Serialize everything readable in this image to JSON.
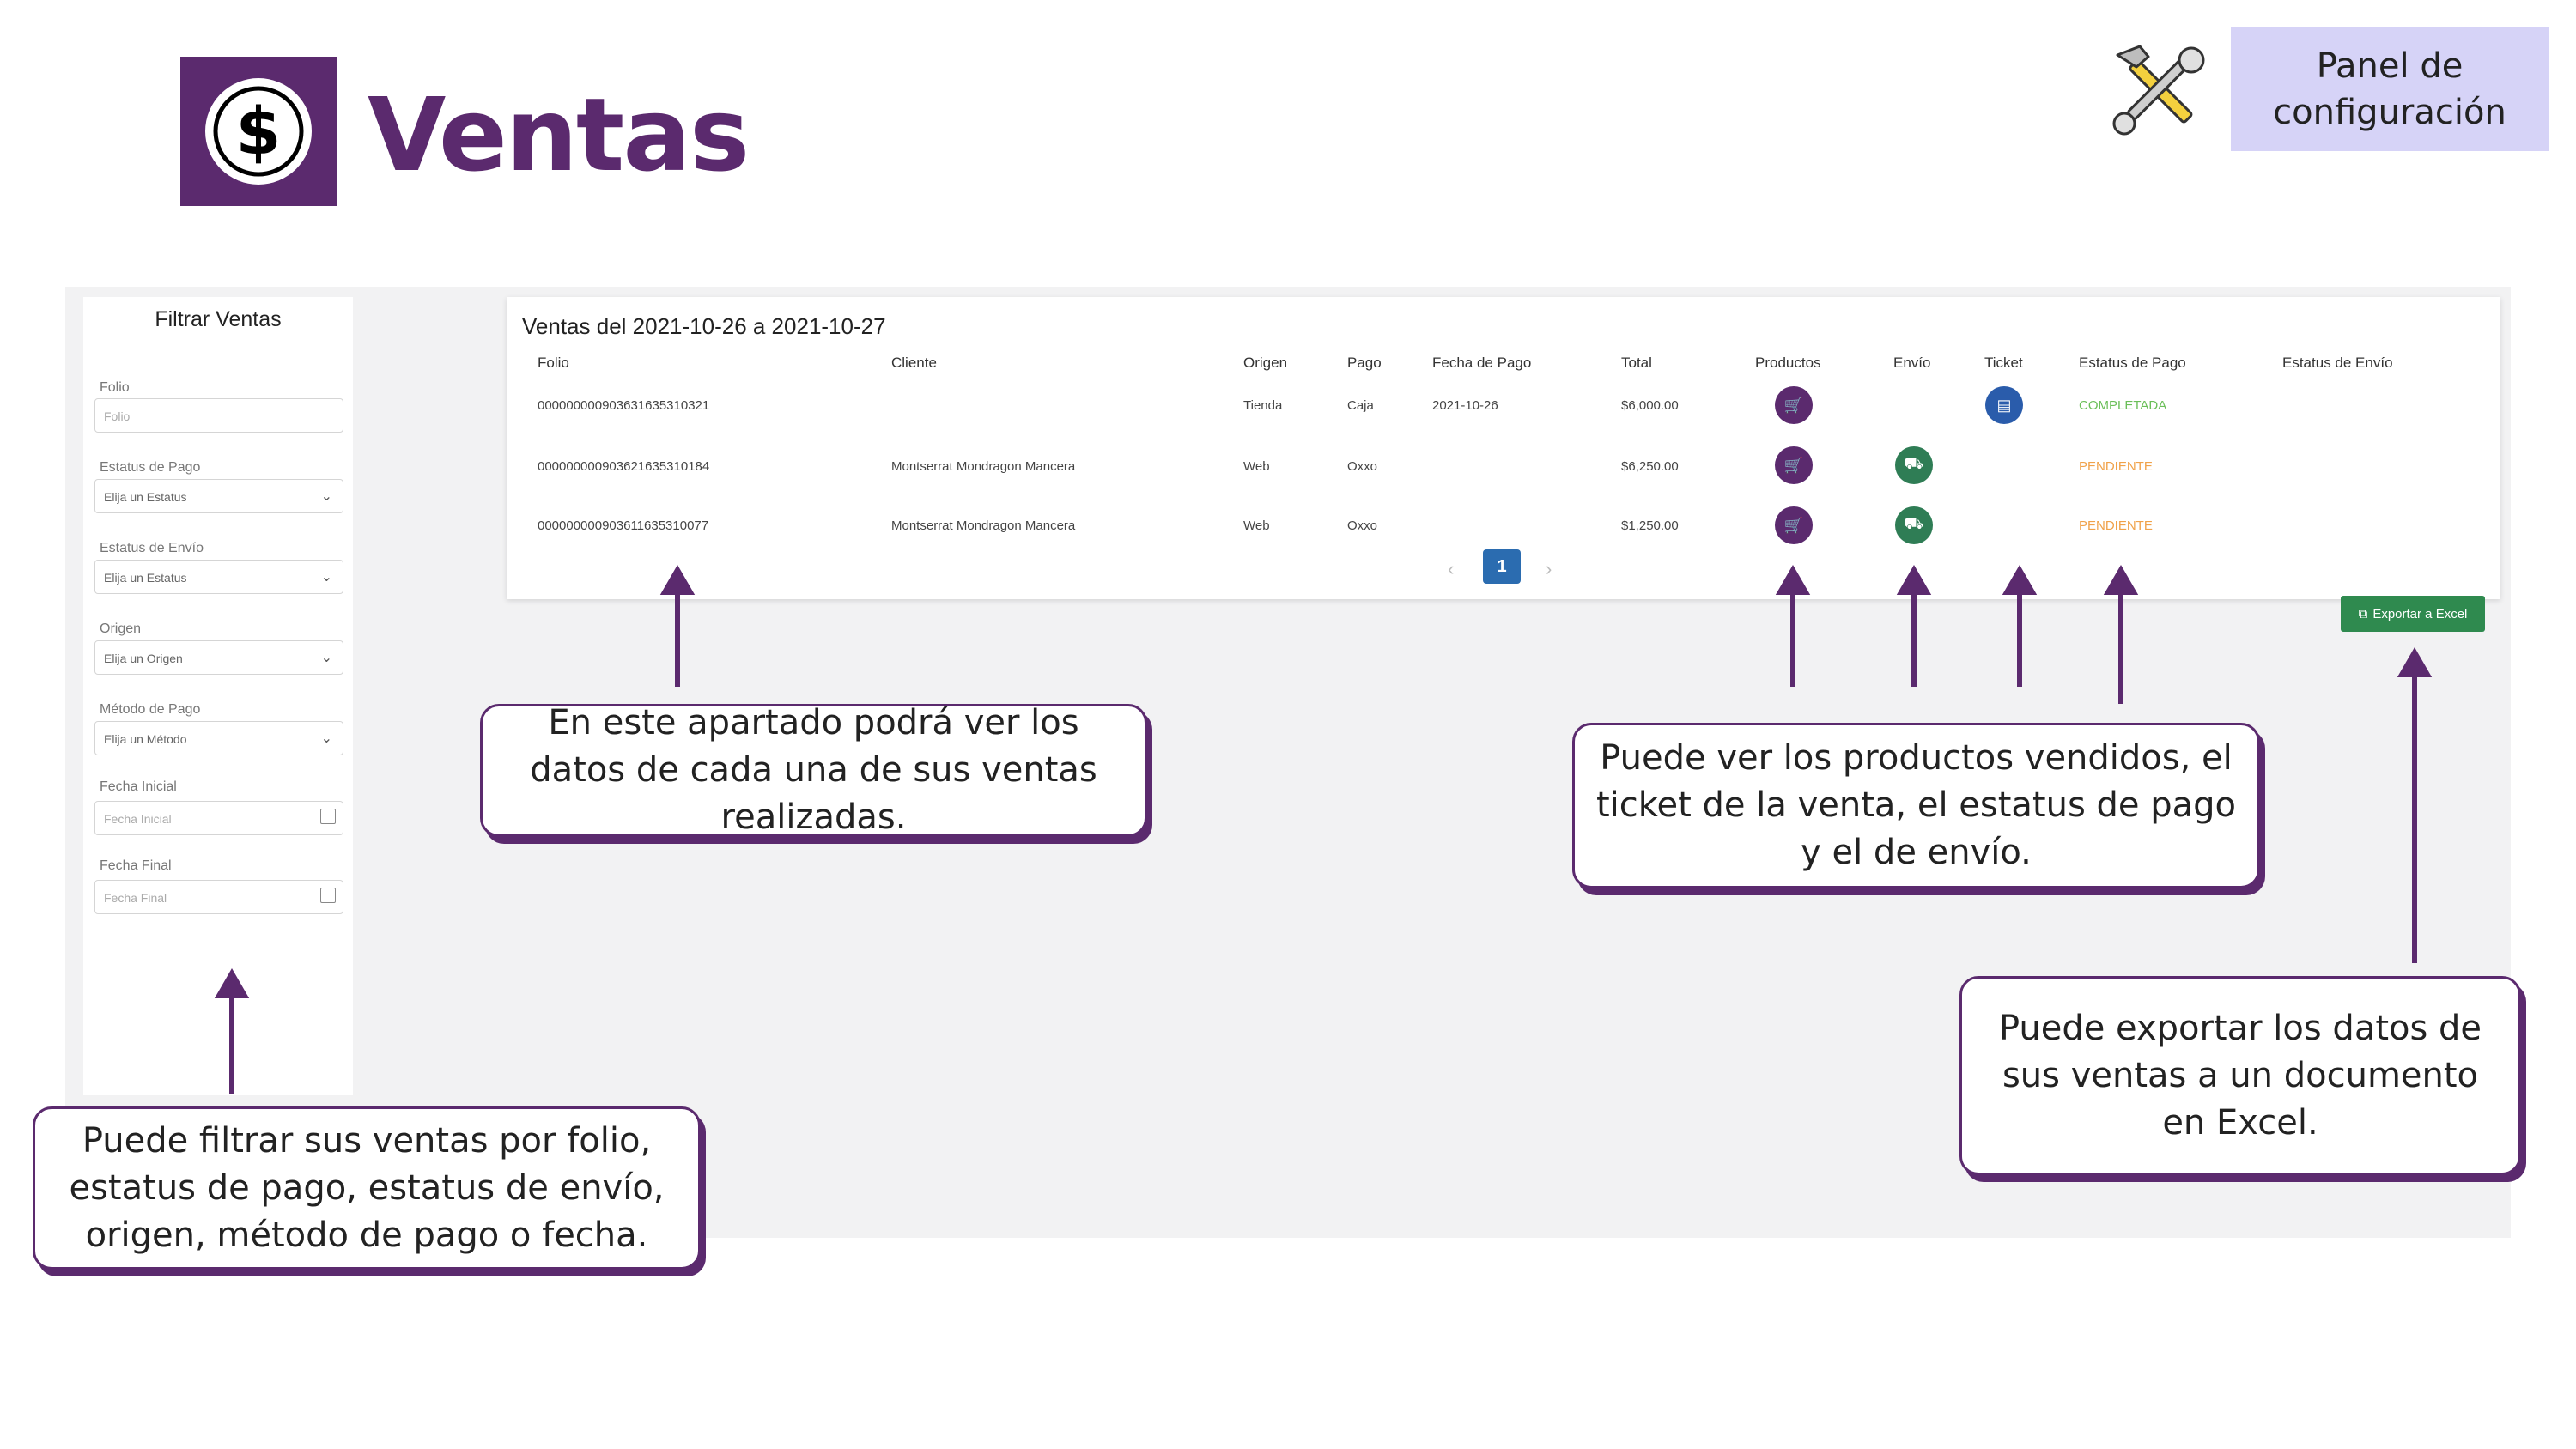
{
  "header": {
    "title": "Ventas",
    "config_panel_label": "Panel de configuración"
  },
  "filters": {
    "title": "Filtrar Ventas",
    "folio": {
      "label": "Folio",
      "placeholder": "Folio"
    },
    "payment_status": {
      "label": "Estatus de Pago",
      "value": "Elija un Estatus"
    },
    "shipping_status": {
      "label": "Estatus de Envío",
      "value": "Elija un Estatus"
    },
    "origin": {
      "label": "Origen",
      "value": "Elija un Origen"
    },
    "payment_method": {
      "label": "Método de Pago",
      "value": "Elija un Método"
    },
    "start_date": {
      "label": "Fecha Inicial",
      "placeholder": "Fecha Inicial"
    },
    "end_date": {
      "label": "Fecha Final",
      "placeholder": "Fecha Final"
    }
  },
  "sales": {
    "heading": "Ventas del 2021-10-26 a 2021-10-27",
    "columns": [
      "Folio",
      "Cliente",
      "Origen",
      "Pago",
      "Fecha de Pago",
      "Total",
      "Productos",
      "Envío",
      "Ticket",
      "Estatus de Pago",
      "Estatus de Envío"
    ],
    "rows": [
      {
        "folio": "000000000903631635310321",
        "cliente": "",
        "origen": "Tienda",
        "pago": "Caja",
        "fecha_pago": "2021-10-26",
        "total": "$6,000.00",
        "estatus_pago": "COMPLETADA",
        "estatus_envio": ""
      },
      {
        "folio": "000000000903621635310184",
        "cliente": "Montserrat Mondragon Mancera",
        "origen": "Web",
        "pago": "Oxxo",
        "fecha_pago": "",
        "total": "$6,250.00",
        "estatus_pago": "PENDIENTE",
        "estatus_envio": ""
      },
      {
        "folio": "000000000903611635310077",
        "cliente": "Montserrat Mondragon Mancera",
        "origen": "Web",
        "pago": "Oxxo",
        "fecha_pago": "",
        "total": "$1,250.00",
        "estatus_pago": "PENDIENTE",
        "estatus_envio": ""
      }
    ],
    "pagination": {
      "current_page": "1",
      "prev": "‹",
      "next": "›"
    },
    "export_label": "Exportar a Excel"
  },
  "callouts": {
    "table": "En este apartado podrá ver los datos de cada una de sus ventas realizadas.",
    "columns": "Puede ver los productos vendidos, el ticket de la venta, el estatus de pago y el de envío.",
    "export": "Puede exportar los datos de sus ventas a un documento en Excel.",
    "filters": "Puede filtrar sus ventas por folio, estatus de pago, estatus de envío, origen, método de pago o fecha."
  },
  "colors": {
    "brand_purple": "#5b2a6e",
    "config_bg": "#d6d3f7",
    "status_completed": "#6bbf59",
    "status_pending": "#f0a24a",
    "export_green": "#2f8a4f",
    "ticket_blue": "#2a5cab",
    "shipping_green": "#2f7d55"
  },
  "icons": {
    "logo": "dollar-coin-icon",
    "config": "tools-icon",
    "products": "cart-icon",
    "shipping": "truck-icon",
    "ticket": "document-icon",
    "export": "external-link-icon"
  }
}
